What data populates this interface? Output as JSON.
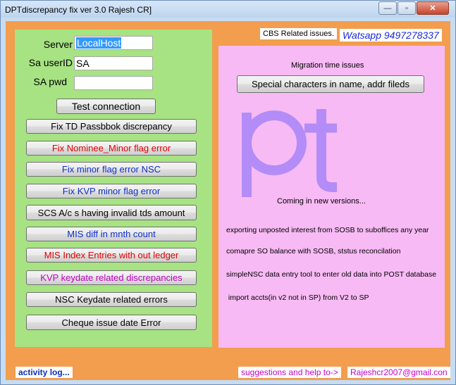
{
  "window": {
    "title": "DPTdiscrepancy fix ver 3.0 Rajesh CR]",
    "minimize_glyph": "—",
    "maximize_glyph": "▫",
    "close_glyph": "✕"
  },
  "connection": {
    "server_label": "Server",
    "server_value": "LocalHost",
    "userid_label": "Sa userID",
    "userid_value": "SA",
    "pwd_label": "SA pwd",
    "pwd_value": "",
    "test_label": "Test connection"
  },
  "fix_buttons": [
    {
      "label": "Fix TD Passbbok discrepancy",
      "color": "#000000"
    },
    {
      "label": "Fix Nominee_Minor flag error",
      "color": "#e00000"
    },
    {
      "label": "Fix minor flag error NSC",
      "color": "#1030c8"
    },
    {
      "label": "Fix KVP minor flag error",
      "color": "#1030c8"
    },
    {
      "label": "SCS A/c s having invalid tds amount",
      "color": "#000000"
    },
    {
      "label": "MIS diff in mnth count",
      "color": "#1030c8"
    },
    {
      "label": "MIS Index Entries with out ledger",
      "color": "#e00000"
    },
    {
      "label": "KVP keydate  related discrepancies",
      "color": "#c000c0"
    },
    {
      "label": "NSC Keydate related errors",
      "color": "#000000"
    },
    {
      "label": "Cheque issue date Error",
      "color": "#000000"
    }
  ],
  "right": {
    "cbs_label": "CBS Related issues.",
    "watsapp_text": "Watsapp  9497278337",
    "migration_heading": "Migration time issues",
    "special_button": "Special characters in name, addr fileds",
    "logo_letters": "pt",
    "coming_text": "Coming in new versions...",
    "future_items": [
      "exporting unposted interest from SOSB to suboffices any year",
      "comapre SO balance with SOSB, ststus reconcilation",
      "simpleNSC data entry tool to enter old data into POST database",
      " import accts(in v2 not in SP) from V2 to SP"
    ],
    "logo_color": "#b38cf7"
  },
  "footer": {
    "activity_label": "activity log...",
    "suggestions_label": "suggestions and help to->",
    "email": "Rajeshcr2007@gmail.con"
  },
  "colors": {
    "orange_bg": "#f39d4e",
    "green_panel": "#a7e283",
    "pink_panel": "#f7baf4"
  }
}
